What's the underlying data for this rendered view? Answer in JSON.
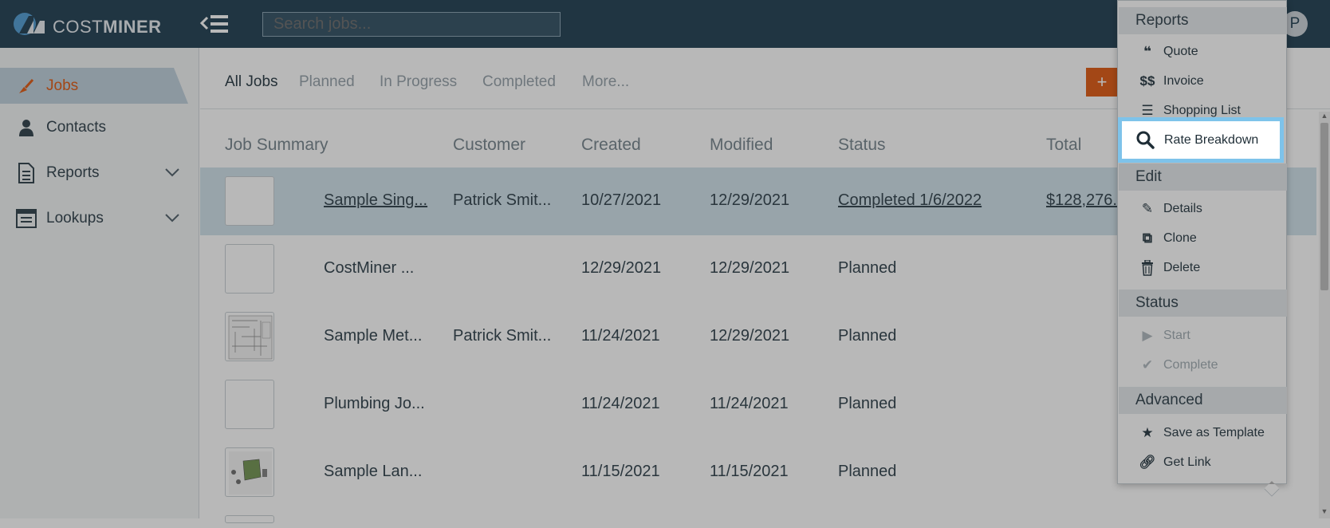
{
  "app": {
    "logo_text_light": "COST",
    "logo_text_bold": "MINER",
    "search_placeholder": "Search jobs...",
    "avatar_initial": "P",
    "accent_color": "#e2631f",
    "topbar_color": "#2d4a5c"
  },
  "sidebar": {
    "items": [
      {
        "label": "Jobs",
        "icon": "trowel-icon",
        "active": true
      },
      {
        "label": "Contacts",
        "icon": "person-icon"
      },
      {
        "label": "Reports",
        "icon": "document-icon",
        "expandable": true
      },
      {
        "label": "Lookups",
        "icon": "list-box-icon",
        "expandable": true
      }
    ]
  },
  "tabs": [
    "All Jobs",
    "Planned",
    "In Progress",
    "Completed",
    "More..."
  ],
  "table": {
    "headers": [
      "Job Summary",
      "Customer",
      "Created",
      "Modified",
      "Status",
      "Total"
    ],
    "rows": [
      {
        "name": "Sample Sing...",
        "customer": "Patrick Smit...",
        "created": "10/27/2021",
        "modified": "12/29/2021",
        "status": "Completed 1/6/2022",
        "total": "$128,276.(",
        "selected": true
      },
      {
        "name": "CostMiner ...",
        "customer": "",
        "created": "12/29/2021",
        "modified": "12/29/2021",
        "status": "Planned",
        "total": ""
      },
      {
        "name": "Sample Met...",
        "customer": "Patrick Smit...",
        "created": "11/24/2021",
        "modified": "12/29/2021",
        "status": "Planned",
        "total": ""
      },
      {
        "name": "Plumbing Jo...",
        "customer": "",
        "created": "11/24/2021",
        "modified": "11/24/2021",
        "status": "Planned",
        "total": ""
      },
      {
        "name": "Sample Lan...",
        "customer": "",
        "created": "11/15/2021",
        "modified": "11/15/2021",
        "status": "Planned",
        "total": ""
      }
    ]
  },
  "dropdown": {
    "sections": {
      "reports": "Reports",
      "edit": "Edit",
      "status": "Status",
      "advanced": "Advanced"
    },
    "items": {
      "quote": "Quote",
      "invoice": "Invoice",
      "shopping_list": "Shopping List",
      "rate_breakdown": "Rate Breakdown",
      "details": "Details",
      "clone": "Clone",
      "delete": "Delete",
      "start": "Start",
      "complete": "Complete",
      "save_as_template": "Save as Template",
      "get_link": "Get Link"
    },
    "highlight_color": "#7ec3ea"
  }
}
